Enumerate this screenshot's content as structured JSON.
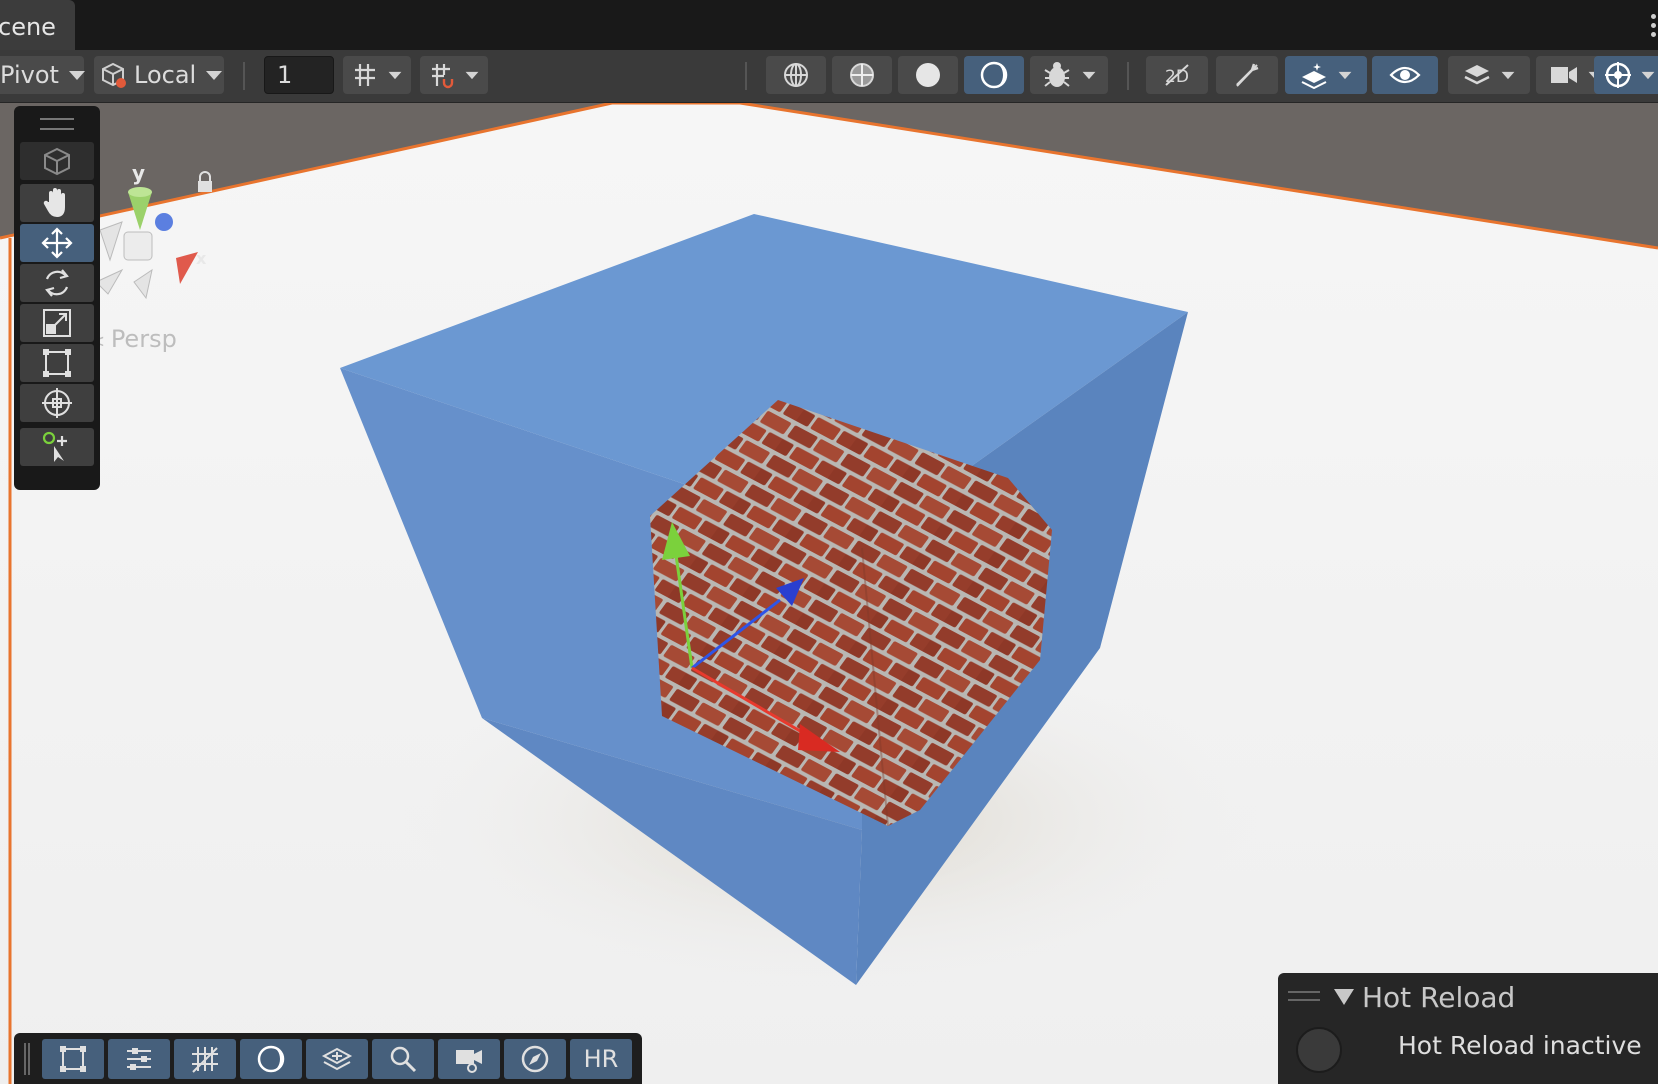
{
  "tab": {
    "title": "cene"
  },
  "toolbar": {
    "pivot_label": "Pivot",
    "space_label": "Local",
    "snap_value": "1",
    "buttons": [
      "grid-snapping-icon",
      "increment-snap-icon",
      "wireframe-shading-icon",
      "shaded-wireframe-icon",
      "shaded-icon",
      "lit-toggle-icon",
      "debug-draw-mode-icon",
      "2d-toggle-icon",
      "lighting-toggle-icon",
      "effects-icon",
      "visibility-icon",
      "layers-icon",
      "camera-icon",
      "gizmos-icon"
    ]
  },
  "viewport": {
    "projection_label": "Persp",
    "axis_y": "y",
    "axis_x": "x",
    "tools": [
      "view-tool",
      "hand-tool",
      "move-tool",
      "rotate-tool",
      "scale-tool",
      "rect-tool",
      "transform-tool",
      "custom-tool"
    ],
    "active_tool": "move-tool"
  },
  "overlay_toolbar": {
    "buttons": [
      "rect-icon",
      "settings-icon",
      "grid-icon",
      "shading-icon",
      "layers-icon",
      "search-icon",
      "camera-overlay-icon",
      "compass-icon"
    ],
    "hr_label": "HR"
  },
  "hot_reload": {
    "title": "Hot Reload",
    "status": "Hot Reload inactive"
  },
  "colors": {
    "accent": "#46607c",
    "selection_outline": "#e8742e",
    "cube": "#6b98d2",
    "ground": "#f4f4f4"
  }
}
